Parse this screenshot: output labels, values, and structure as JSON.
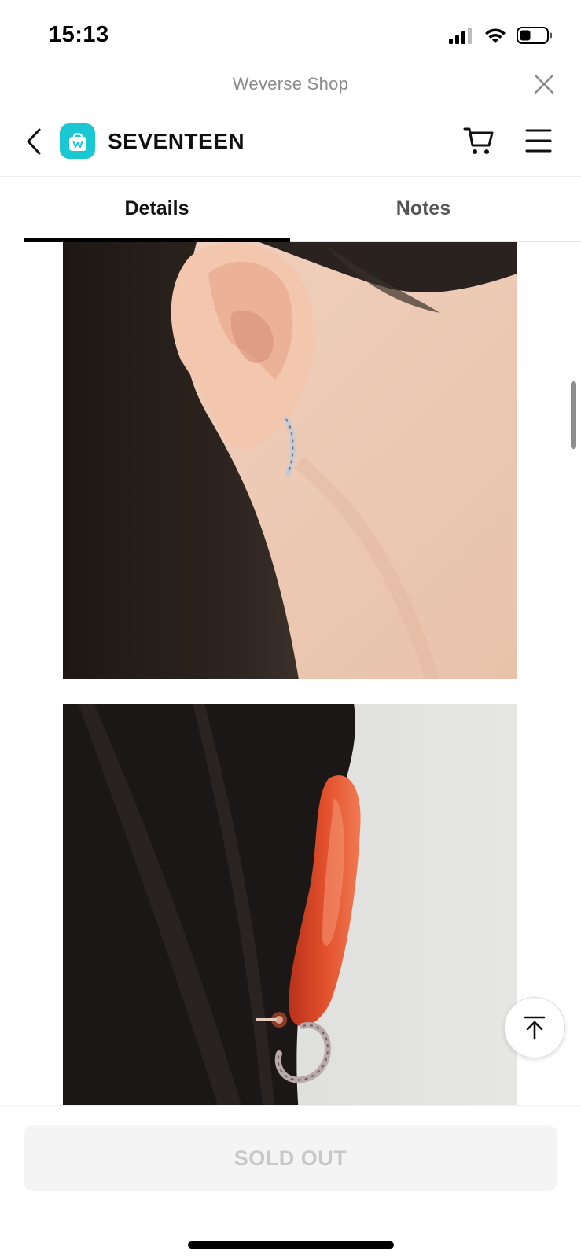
{
  "status_bar": {
    "time": "15:13",
    "icons": [
      "signal-icon",
      "wifi-icon",
      "battery-icon"
    ]
  },
  "webview": {
    "title": "Weverse Shop",
    "close_icon": "close-icon"
  },
  "header": {
    "back_icon": "chevron-left-icon",
    "logo_icon": "weverse-shop-bag-icon",
    "artist": "SEVENTEEN",
    "cart_icon": "cart-icon",
    "menu_icon": "hamburger-menu-icon",
    "accent_color": "#19c8d2"
  },
  "tabs": [
    {
      "label": "Details",
      "active": true
    },
    {
      "label": "Notes",
      "active": false
    }
  ],
  "content": {
    "images": [
      {
        "subject": "ear-with-twisted-silver-hoop-earring-front"
      },
      {
        "subject": "ear-with-twisted-hoop-earring-back-view"
      }
    ]
  },
  "scroll_top_icon": "arrow-up-to-top-icon",
  "purchase": {
    "label": "SOLD OUT",
    "enabled": false
  }
}
